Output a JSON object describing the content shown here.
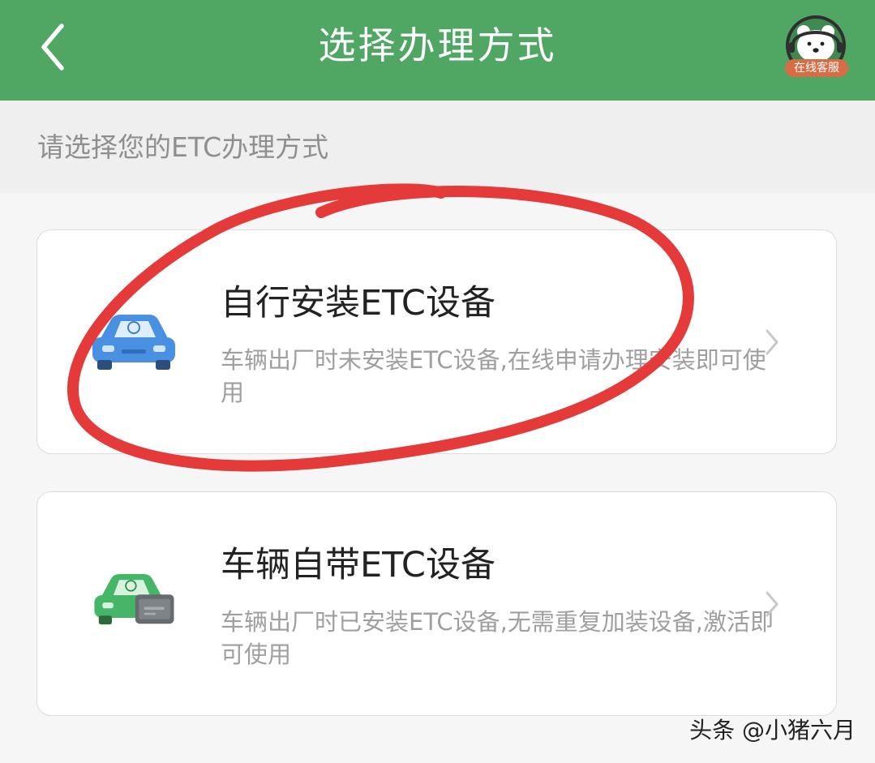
{
  "header": {
    "title": "选择办理方式",
    "service_label": "在线客服",
    "back_icon": "chevron-left-icon",
    "service_icon": "bear-avatar-icon"
  },
  "subhead": {
    "text": "请选择您的ETC办理方式"
  },
  "options": [
    {
      "title": "自行安装ETC设备",
      "description": "车辆出厂时未安装ETC设备,在线申请办理安装即可使用",
      "icon": "blue-car-icon"
    },
    {
      "title": "车辆自带ETC设备",
      "description": "车辆出厂时已安装ETC设备,无需重复加装设备,激活即可使用",
      "icon": "green-car-etc-icon"
    }
  ],
  "watermark": "头条 @小猪六月",
  "colors": {
    "header": "#4fa763",
    "annotation": "#e53a3a",
    "blue_car": "#4a90e2",
    "green_car": "#45b567"
  }
}
